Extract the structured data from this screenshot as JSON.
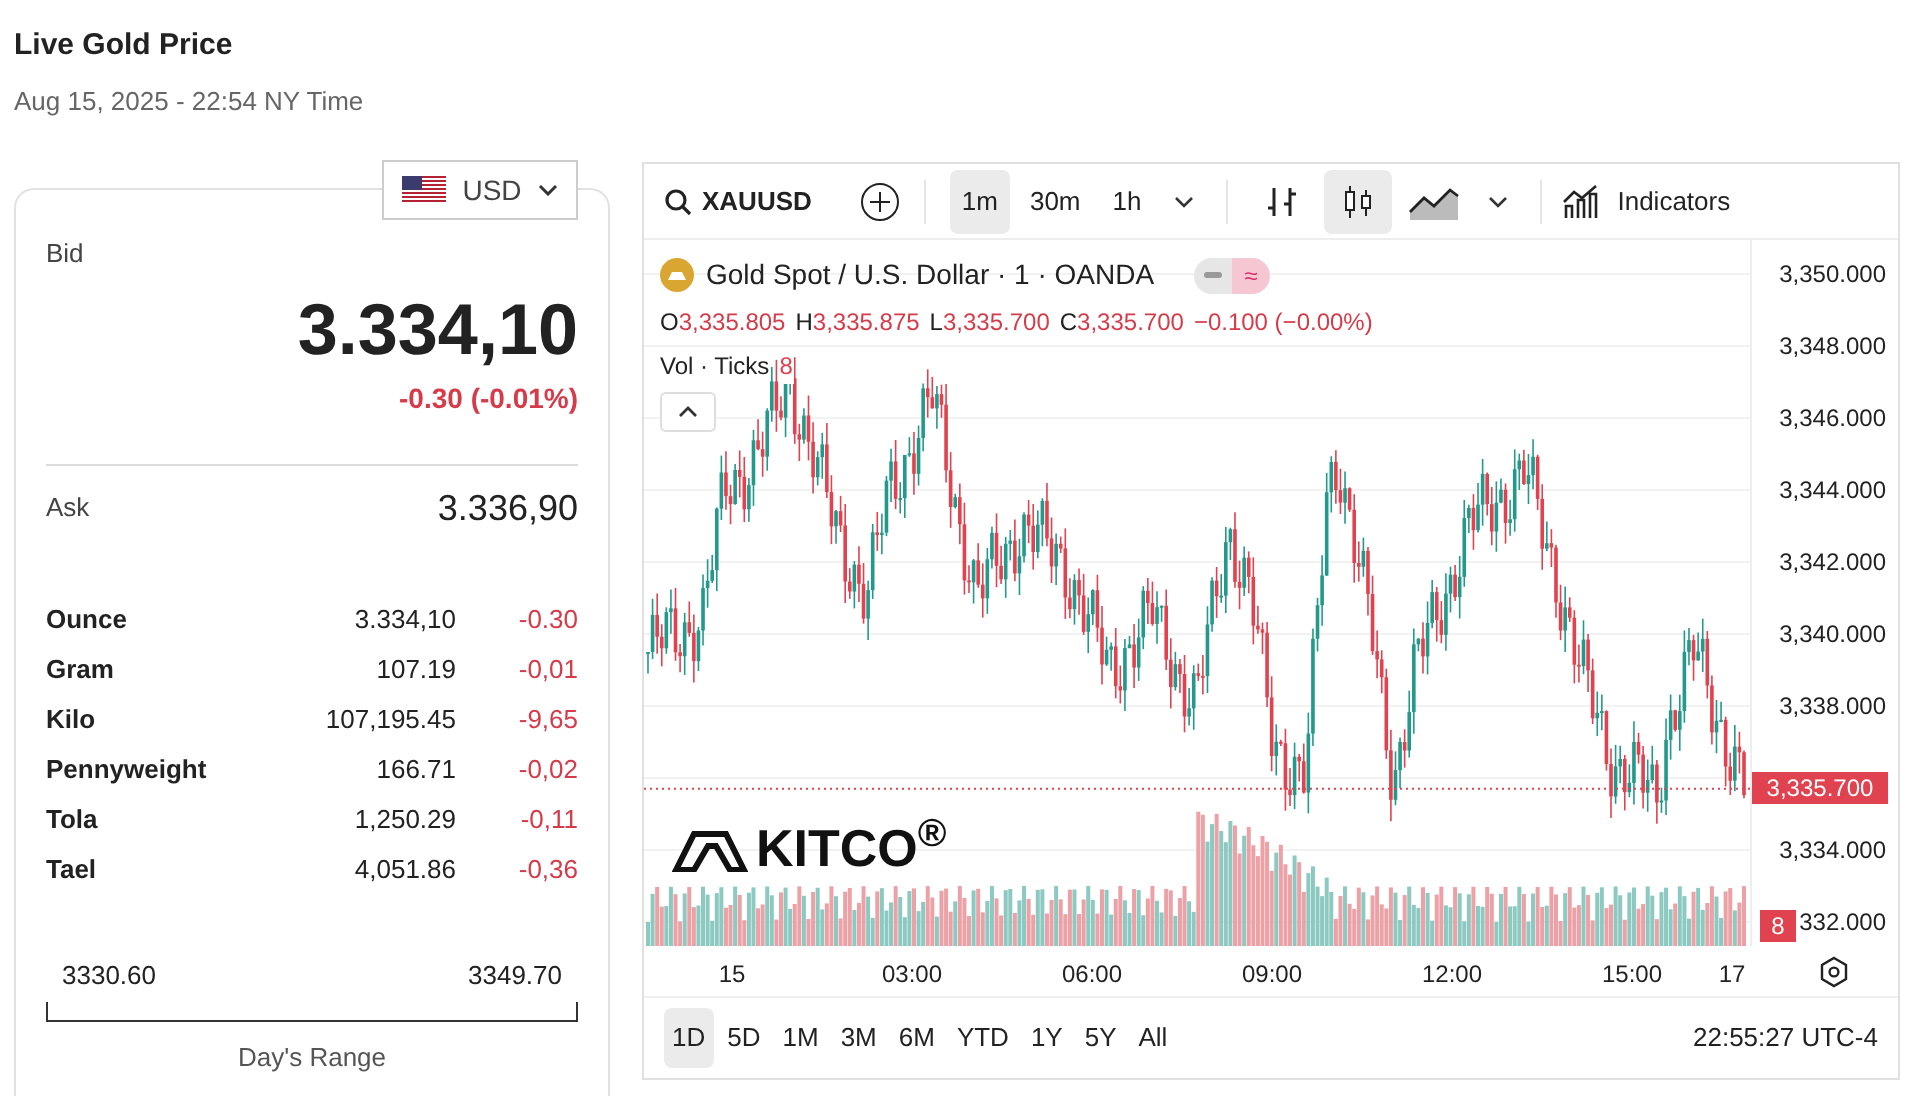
{
  "header": {
    "title": "Live Gold Price",
    "timestamp": "Aug 15, 2025 - 22:54 NY Time"
  },
  "currency": {
    "code": "USD"
  },
  "bid": {
    "label": "Bid",
    "price": "3.334,10",
    "change": "-0.30 (-0.01%)"
  },
  "ask": {
    "label": "Ask",
    "price": "3.336,90"
  },
  "units": [
    {
      "name": "Ounce",
      "price": "3.334,10",
      "change": "-0.30"
    },
    {
      "name": "Gram",
      "price": "107.19",
      "change": "-0,01"
    },
    {
      "name": "Kilo",
      "price": "107,195.45",
      "change": "-9,65"
    },
    {
      "name": "Pennyweight",
      "price": "166.71",
      "change": "-0,02"
    },
    {
      "name": "Tola",
      "price": "1,250.29",
      "change": "-0,11"
    },
    {
      "name": "Tael",
      "price": "4,051.86",
      "change": "-0,36"
    }
  ],
  "day_range": {
    "low": "3330.60",
    "high": "3349.70",
    "label": "Day's Range"
  },
  "chart": {
    "symbol": "XAUUSD",
    "intervals": [
      {
        "label": "1m",
        "selected": true
      },
      {
        "label": "30m",
        "selected": false
      },
      {
        "label": "1h",
        "selected": false
      }
    ],
    "chart_types": [
      {
        "kind": "bars",
        "selected": false
      },
      {
        "kind": "candles",
        "selected": true
      },
      {
        "kind": "area",
        "selected": false
      }
    ],
    "indicators": "Indicators",
    "title": "Gold Spot / U.S. Dollar · 1 · OANDA",
    "legend_toggle": {
      "symbol": "≈"
    },
    "ohlc": [
      {
        "key": "O",
        "value": "3,335.805"
      },
      {
        "key": "H",
        "value": "3,335.875"
      },
      {
        "key": "L",
        "value": "3,335.700"
      },
      {
        "key": "C",
        "value": "3,335.700"
      }
    ],
    "change": "−0.100 (−0.00%)",
    "volume_label": "Vol · Ticks",
    "volume_value": "8",
    "watermark": "KITCO$^{®}$",
    "price_axis": [
      {
        "kind": "tick",
        "label": "3,350.000"
      },
      {
        "kind": "tick",
        "label": "3,348.000"
      },
      {
        "kind": "tick",
        "label": "3,346.000"
      },
      {
        "kind": "tick",
        "label": "3,344.000"
      },
      {
        "kind": "tick",
        "label": "3,342.000"
      },
      {
        "kind": "tick",
        "label": "3,340.000"
      },
      {
        "kind": "tick",
        "label": "3,338.000"
      },
      {
        "kind": "last_price",
        "label": "3,335.700"
      },
      {
        "kind": "tick",
        "label": "3,334.000"
      },
      {
        "kind": "tick",
        "label": "332.000"
      }
    ],
    "last_volume": "8",
    "time_axis": [
      "15",
      "03:00",
      "06:00",
      "09:00",
      "12:00",
      "15:00",
      "17"
    ],
    "ranges": [
      {
        "label": "1D",
        "selected": true
      },
      {
        "label": "5D",
        "selected": false
      },
      {
        "label": "1M",
        "selected": false
      },
      {
        "label": "3M",
        "selected": false
      },
      {
        "label": "6M",
        "selected": false
      },
      {
        "label": "YTD",
        "selected": false
      },
      {
        "label": "1Y",
        "selected": false
      },
      {
        "label": "5Y",
        "selected": false
      },
      {
        "label": "All",
        "selected": false
      }
    ],
    "clock": "22:55:27 UTC-4"
  }
}
